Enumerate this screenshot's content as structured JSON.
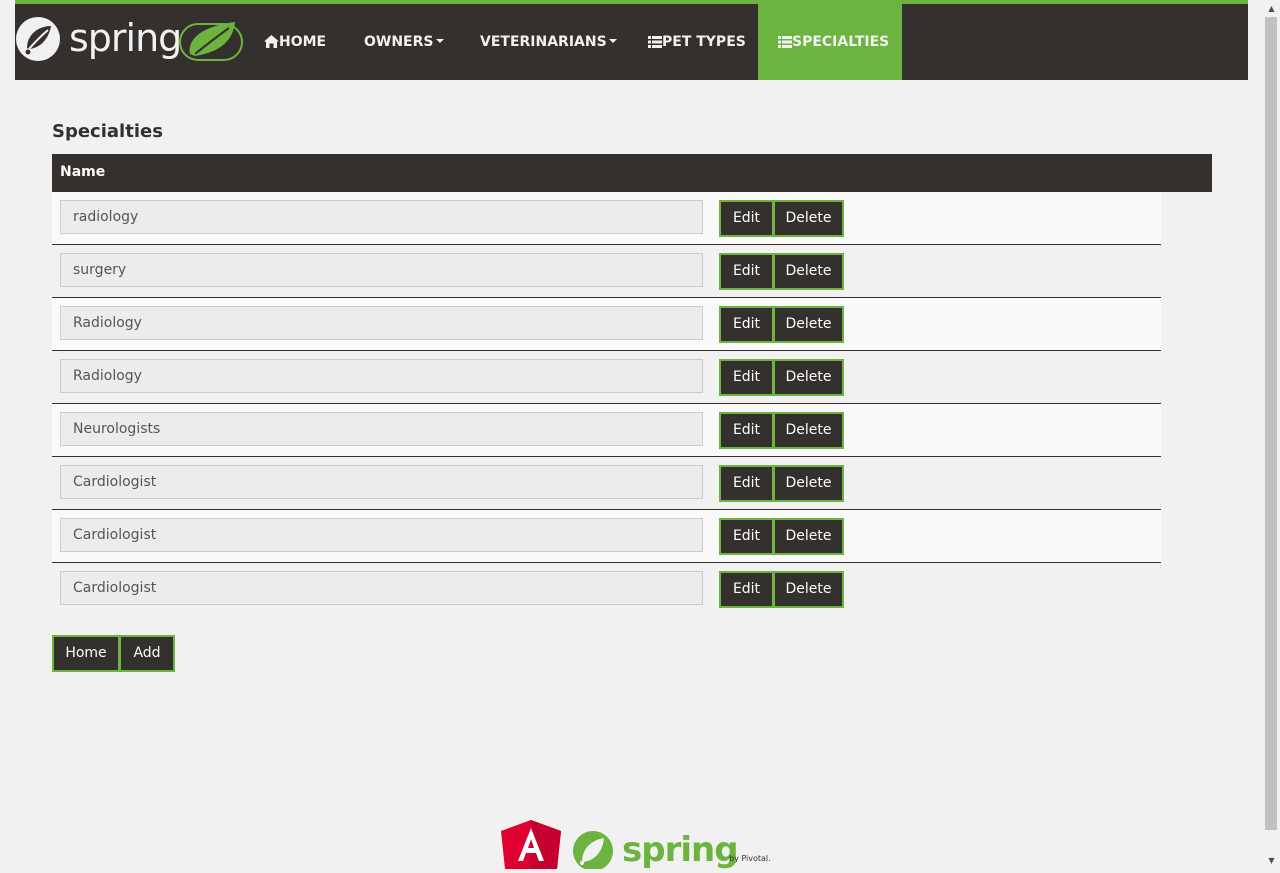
{
  "navbar": {
    "brand_logo": "spring-logo",
    "items": [
      {
        "label": "HOME",
        "icon": "home-icon"
      },
      {
        "label": "OWNERS",
        "icon": "caret-down-icon"
      },
      {
        "label": "VETERINARIANS",
        "icon": "caret-down-icon"
      },
      {
        "label": "PET TYPES",
        "icon": "list-icon"
      },
      {
        "label": "SPECIALTIES",
        "icon": "list-icon",
        "active": true
      }
    ]
  },
  "page": {
    "title": "Specialties",
    "table_header": "Name",
    "rows": [
      {
        "name": "radiology"
      },
      {
        "name": "surgery"
      },
      {
        "name": "Radiology"
      },
      {
        "name": "Radiology"
      },
      {
        "name": "Neurologists"
      },
      {
        "name": "Cardiologist"
      },
      {
        "name": "Cardiologist"
      },
      {
        "name": "Cardiologist"
      }
    ],
    "edit_label": "Edit",
    "delete_label": "Delete",
    "home_label": "Home",
    "add_label": "Add"
  },
  "footer": {
    "logos": [
      "angular-logo",
      "spring-by-pivotal-logo"
    ],
    "logo_text": "spring",
    "logo_subtext": "by Pivotal."
  },
  "colors": {
    "brand_green": "#6db33f",
    "dark": "#34302d",
    "background": "#f1f1f1",
    "angular_red": "#dd0031"
  }
}
